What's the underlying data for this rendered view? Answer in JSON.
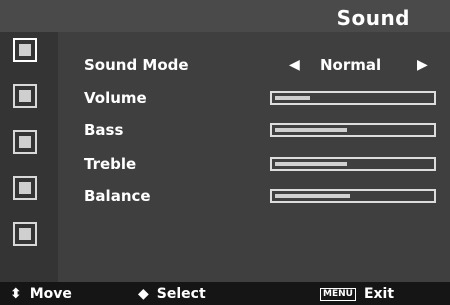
{
  "header": {
    "title": "Sound"
  },
  "sidebar": {
    "icons": [
      "picture-icon",
      "settings-icon",
      "channel-icon",
      "hand-icon",
      "display-icon"
    ],
    "active_index": 0
  },
  "sound": {
    "sound_mode_label": "Sound Mode",
    "sound_mode_value": "Normal",
    "volume_label": "Volume",
    "volume_level": 0.25,
    "bass_label": "Bass",
    "bass_level": 0.48,
    "treble_label": "Treble",
    "treble_level": 0.48,
    "balance_label": "Balance",
    "balance_level": 0.5
  },
  "footer": {
    "move_label": "Move",
    "select_label": "Select",
    "menu_key": "MENU",
    "exit_label": "Exit"
  }
}
